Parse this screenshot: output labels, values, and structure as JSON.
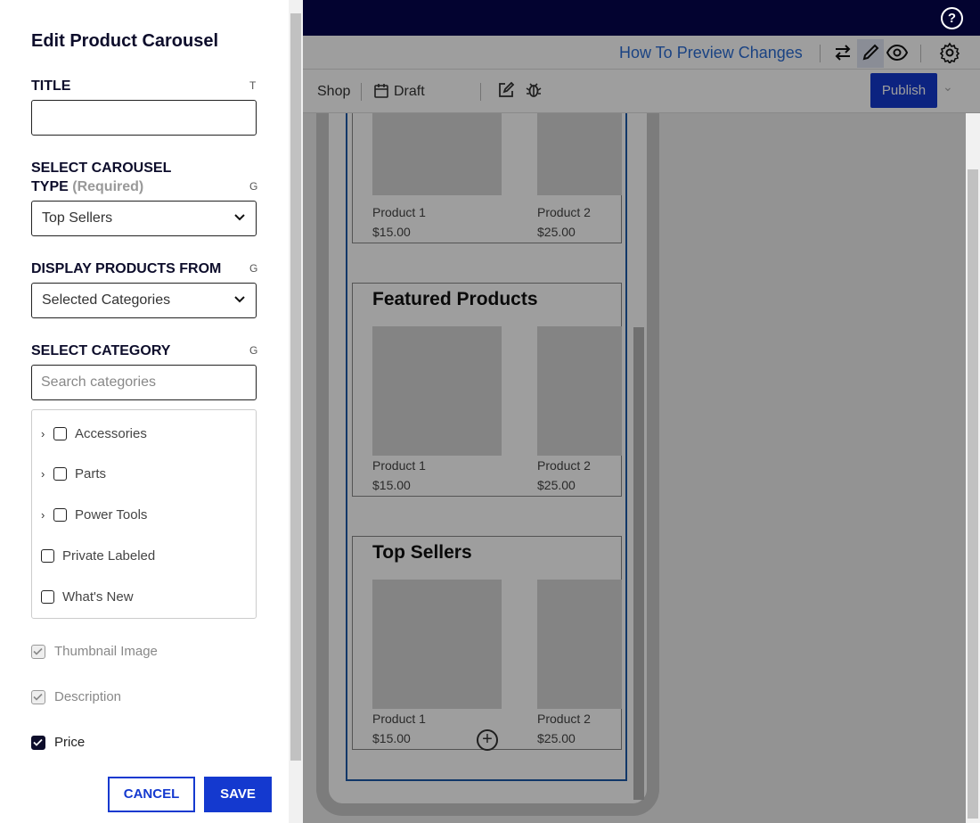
{
  "header": {
    "help_glyph": "?",
    "preview_link": "How To Preview Changes",
    "breadcrumb": {
      "shop": "Shop",
      "status": "Draft"
    },
    "publish_label": "Publish"
  },
  "preview": {
    "carousels": [
      {
        "title": "",
        "products": [
          {
            "name": "Product 1",
            "price": "$15.00"
          },
          {
            "name": "Product 2",
            "price": "$25.00"
          }
        ]
      },
      {
        "title": "Featured Products",
        "products": [
          {
            "name": "Product 1",
            "price": "$15.00"
          },
          {
            "name": "Product 2",
            "price": "$25.00"
          }
        ]
      },
      {
        "title": "Top Sellers",
        "products": [
          {
            "name": "Product 1",
            "price": "$15.00"
          },
          {
            "name": "Product 2",
            "price": "$25.00"
          }
        ]
      }
    ],
    "add_glyph": "+"
  },
  "panel": {
    "title": "Edit Product Carousel",
    "fields": {
      "title": {
        "label": "TITLE",
        "hint": "T",
        "value": ""
      },
      "carousel_type": {
        "label_line1": "SELECT CAROUSEL",
        "label_line2": "TYPE",
        "required": "(Required)",
        "hint": "G",
        "value": "Top Sellers"
      },
      "display_from": {
        "label": "DISPLAY PRODUCTS FROM",
        "hint": "G",
        "value": "Selected Categories"
      },
      "category": {
        "label": "SELECT CATEGORY",
        "hint": "G",
        "placeholder": "Search categories"
      }
    },
    "categories": [
      {
        "label": "Accessories",
        "expandable": true,
        "checked": false
      },
      {
        "label": "Parts",
        "expandable": true,
        "checked": false
      },
      {
        "label": "Power Tools",
        "expandable": true,
        "checked": false
      },
      {
        "label": "Private Labeled",
        "expandable": false,
        "checked": false
      },
      {
        "label": "What's New",
        "expandable": false,
        "checked": false
      }
    ],
    "options": [
      {
        "label": "Thumbnail Image",
        "checked": true,
        "disabled": true
      },
      {
        "label": "Description",
        "checked": true,
        "disabled": true
      },
      {
        "label": "Price",
        "checked": true,
        "disabled": false
      }
    ],
    "cancel_label": "CANCEL",
    "save_label": "SAVE"
  },
  "colors": {
    "accent": "#1439cf",
    "topbar": "#030330",
    "link": "#2b6cd4"
  }
}
